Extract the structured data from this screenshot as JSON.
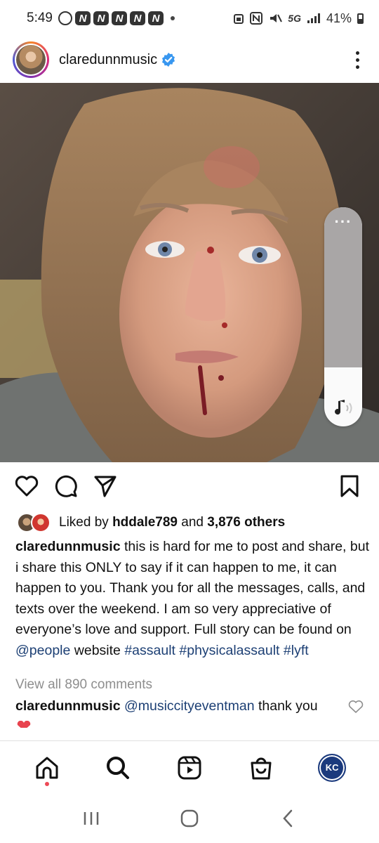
{
  "status_bar": {
    "time": "5:49",
    "network": "5G",
    "battery": "41%"
  },
  "post": {
    "username": "claredunnmusic",
    "verified": true,
    "likes": {
      "prefix": "Liked by",
      "liker": "hddale789",
      "connector": "and",
      "others": "3,876 others"
    },
    "caption": {
      "username": "claredunnmusic",
      "text1": "this is hard for me to post and share, but i share this ONLY to say if it can happen to me, it can happen to you. Thank you for all the messages, calls, and texts over the weekend. I am so very appreciative of everyone’s love and support. Full story can be found on",
      "mention": "@people",
      "text2": "website",
      "tag1": "#assault",
      "tag2": "#physicalassault",
      "tag3": "#lyft"
    },
    "view_all_comments": "View all 890 comments",
    "comment": {
      "username": "claredunnmusic",
      "mention": "@musiccityeventman",
      "text": "thank you"
    }
  },
  "bottom_nav": {
    "profile_initials": "KC"
  },
  "colors": {
    "link": "#1c3f74",
    "verified": "#3897f0",
    "muted": "#8e8e8e",
    "notification_dot": "#ed4956"
  },
  "icons": [
    "search-icon",
    "home-icon",
    "reels-icon",
    "shop-icon",
    "heart-icon",
    "comment-icon",
    "share-icon",
    "bookmark-icon",
    "more-icon",
    "music-note-icon"
  ]
}
